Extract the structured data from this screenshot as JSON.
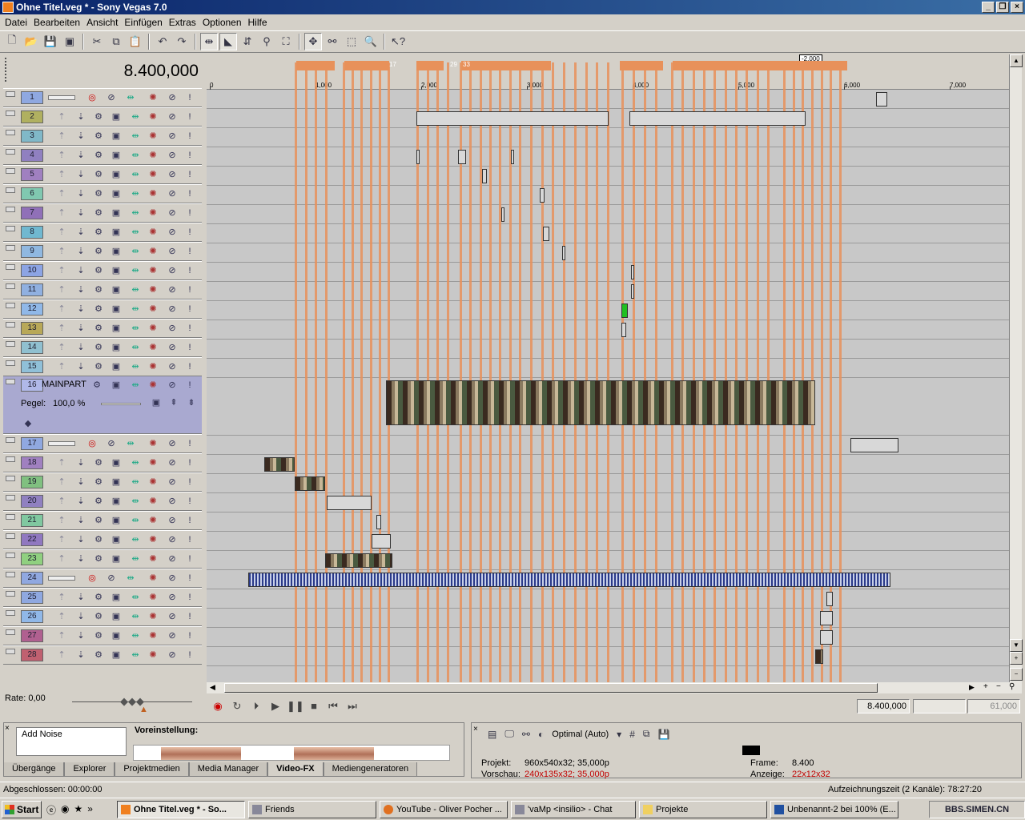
{
  "window": {
    "title": "Ohne Titel.veg * - Sony Vegas 7.0"
  },
  "menu": [
    "Datei",
    "Bearbeiten",
    "Ansicht",
    "Einfügen",
    "Extras",
    "Optionen",
    "Hilfe"
  ],
  "time_display": "8.400,000",
  "ruler": {
    "ticks": [
      "0",
      "1,000",
      "2,000",
      "3,000",
      "4,000",
      "5,000",
      "6,000",
      "7,000"
    ],
    "region_label": "-2,000",
    "marker_labels": [
      "17",
      "29",
      "33"
    ]
  },
  "tracks": [
    {
      "n": "1",
      "color": "#8fa8e0",
      "type": "audio"
    },
    {
      "n": "2",
      "color": "#b0b060",
      "type": "video"
    },
    {
      "n": "3",
      "color": "#80b8c8",
      "type": "video"
    },
    {
      "n": "4",
      "color": "#9080c0",
      "type": "video"
    },
    {
      "n": "5",
      "color": "#a080c0",
      "type": "video"
    },
    {
      "n": "6",
      "color": "#80c8b0",
      "type": "video"
    },
    {
      "n": "7",
      "color": "#9070b8",
      "type": "video"
    },
    {
      "n": "8",
      "color": "#70b8d0",
      "type": "video"
    },
    {
      "n": "9",
      "color": "#90b8e0",
      "type": "video"
    },
    {
      "n": "10",
      "color": "#8ca4e4",
      "type": "video"
    },
    {
      "n": "11",
      "color": "#90b0e0",
      "type": "video"
    },
    {
      "n": "12",
      "color": "#90b8e8",
      "type": "video"
    },
    {
      "n": "13",
      "color": "#b8a858",
      "type": "video"
    },
    {
      "n": "14",
      "color": "#90c0d0",
      "type": "video"
    },
    {
      "n": "15",
      "color": "#90c0d8",
      "type": "video"
    },
    {
      "n": "16",
      "color": "#b0b8e8",
      "type": "video",
      "name": "MAINPART"
    },
    {
      "n": "17",
      "color": "#90a8e0",
      "type": "audio"
    },
    {
      "n": "18",
      "color": "#a080c0",
      "type": "video"
    },
    {
      "n": "19",
      "color": "#80c080",
      "type": "video"
    },
    {
      "n": "20",
      "color": "#9080c0",
      "type": "video"
    },
    {
      "n": "21",
      "color": "#80c8a0",
      "type": "video"
    },
    {
      "n": "22",
      "color": "#9078c0",
      "type": "video"
    },
    {
      "n": "23",
      "color": "#90d080",
      "type": "video"
    },
    {
      "n": "24",
      "color": "#90a8e0",
      "type": "audio"
    },
    {
      "n": "25",
      "color": "#8fa8e0",
      "type": "video"
    },
    {
      "n": "26",
      "color": "#90b8e8",
      "type": "video"
    },
    {
      "n": "27",
      "color": "#b06090",
      "type": "video"
    },
    {
      "n": "28",
      "color": "#c06070",
      "type": "video"
    }
  ],
  "track16": {
    "pegel_label": "Pegel:",
    "pegel_value": "100,0 %"
  },
  "rate": "Rate: 0,00",
  "transport": {
    "time": "8.400,000",
    "field2": "",
    "field3": "61,000"
  },
  "fx": {
    "list_item": "Add Noise",
    "preset_label": "Voreinstellung:",
    "tabs": [
      "Übergänge",
      "Explorer",
      "Projektmedien",
      "Media Manager",
      "Video-FX",
      "Mediengeneratoren"
    ],
    "selected_tab": "Video-FX"
  },
  "preview": {
    "quality": "Optimal (Auto)",
    "projekt_label": "Projekt:",
    "projekt_value": "960x540x32; 35,000p",
    "vorschau_label": "Vorschau:",
    "vorschau_value": "240x135x32; 35,000p",
    "frame_label": "Frame:",
    "frame_value": "8.400",
    "anzeige_label": "Anzeige:",
    "anzeige_value": "22x12x32"
  },
  "status": {
    "left": "Abgeschlossen: 00:00:00",
    "right": "Aufzeichnungszeit (2 Kanäle): 78:27:20"
  },
  "taskbar": {
    "start": "Start",
    "tasks": [
      "Ohne Titel.veg * - So...",
      "Friends",
      "YouTube - Oliver Pocher ...",
      "'vaMp <insilio> - Chat",
      "Projekte",
      "Unbenannt-2 bei 100% (E..."
    ],
    "tray": "BBS.SIMEN.CN"
  }
}
